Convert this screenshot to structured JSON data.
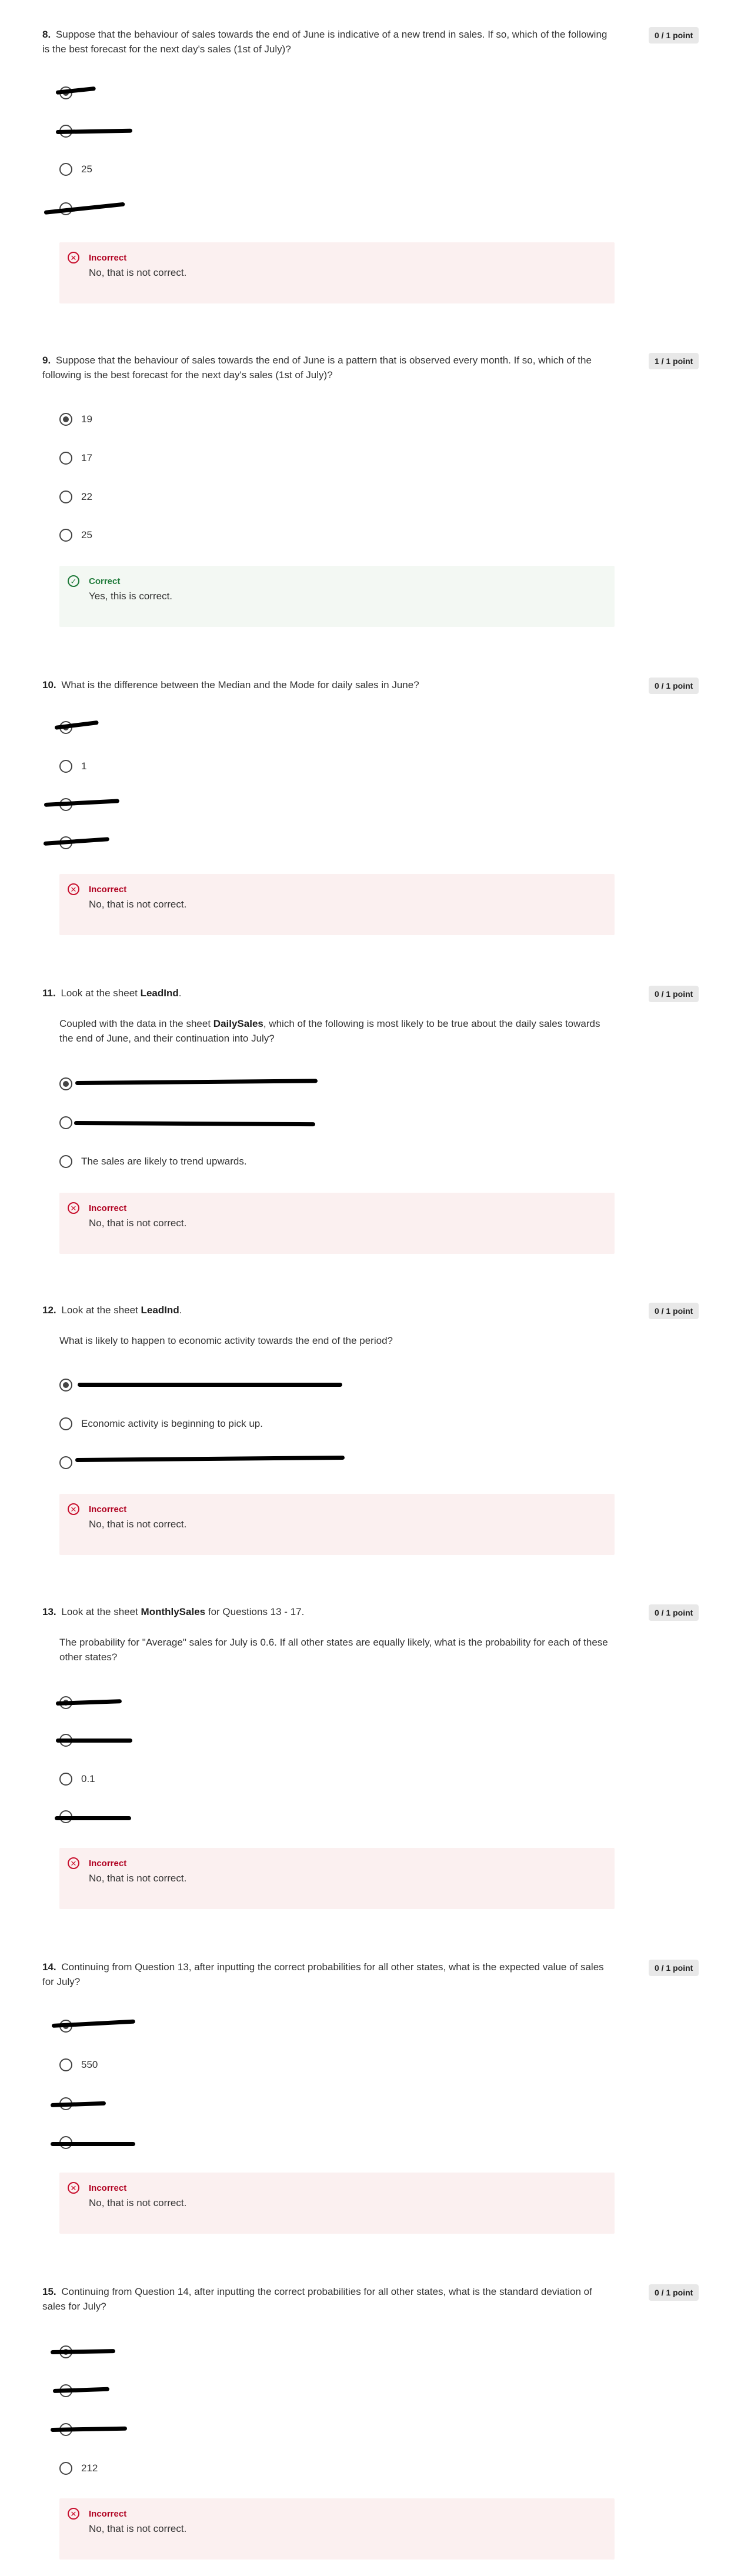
{
  "q8": {
    "number": "8.",
    "text": "Suppose that the behaviour of sales towards the end of June is indicative of a new trend in sales. If so, which of the following is the best forecast for the next day's sales (1st of July)?",
    "score": "0 / 1 point",
    "options": [
      "",
      "",
      "25",
      ""
    ],
    "feedback_title": "Incorrect",
    "feedback_text": "No, that is not correct."
  },
  "q9": {
    "number": "9.",
    "text": "Suppose that the behaviour of sales towards the end of June is a pattern that is observed every month. If so, which of the following is the best forecast for the next day's sales (1st of July)?",
    "score": "1 / 1 point",
    "options": [
      "19",
      "17",
      "22",
      "25"
    ],
    "feedback_title": "Correct",
    "feedback_text": "Yes, this is correct."
  },
  "q10": {
    "number": "10.",
    "text": "What is the difference between the Median and the Mode for daily sales in June?",
    "score": "0 / 1 point",
    "options": [
      "",
      "1",
      "",
      ""
    ],
    "feedback_title": "Incorrect",
    "feedback_text": "No, that is not correct."
  },
  "q11": {
    "number": "11.",
    "lead_pre": "Look at the sheet ",
    "lead_bold": "LeadInd",
    "lead_post": ".",
    "para_pre": "Coupled with the data in the sheet ",
    "para_bold": "DailySales",
    "para_post": ", which of the following is most likely to be true about the daily sales towards the end of June, and their continuation into July?",
    "score": "0 / 1 point",
    "options": [
      "",
      "",
      "The sales are likely to trend upwards."
    ],
    "feedback_title": "Incorrect",
    "feedback_text": "No, that is not correct."
  },
  "q12": {
    "number": "12.",
    "lead_pre": "Look at the sheet ",
    "lead_bold": "LeadInd",
    "lead_post": ".",
    "para": "What is likely to happen to economic activity towards the end of the period?",
    "score": "0 / 1 point",
    "options": [
      "",
      "Economic activity is beginning to pick up.",
      ""
    ],
    "feedback_title": "Incorrect",
    "feedback_text": "No, that is not correct."
  },
  "q13": {
    "number": "13.",
    "lead_pre": "Look at the sheet ",
    "lead_bold": "MonthlySales",
    "lead_post": " for Questions 13 - 17.",
    "para": "The probability for \"Average\" sales for July is 0.6. If all other states are equally likely, what is the probability for each of these other states?",
    "score": "0 / 1 point",
    "options": [
      "",
      "",
      "0.1",
      ""
    ],
    "feedback_title": "Incorrect",
    "feedback_text": "No, that is not correct."
  },
  "q14": {
    "number": "14.",
    "text": "Continuing from Question 13, after inputting the correct probabilities for all other states, what is the expected value of sales for July?",
    "score": "0 / 1 point",
    "options": [
      "",
      "550",
      "",
      ""
    ],
    "feedback_title": "Incorrect",
    "feedback_text": "No, that is not correct."
  },
  "q15": {
    "number": "15.",
    "text": "Continuing from Question 14, after inputting the correct probabilities for all other states, what is the standard deviation of sales for July?",
    "score": "0 / 1 point",
    "options": [
      "",
      "",
      "",
      "212"
    ],
    "feedback_title": "Incorrect",
    "feedback_text": "No, that is not correct."
  }
}
